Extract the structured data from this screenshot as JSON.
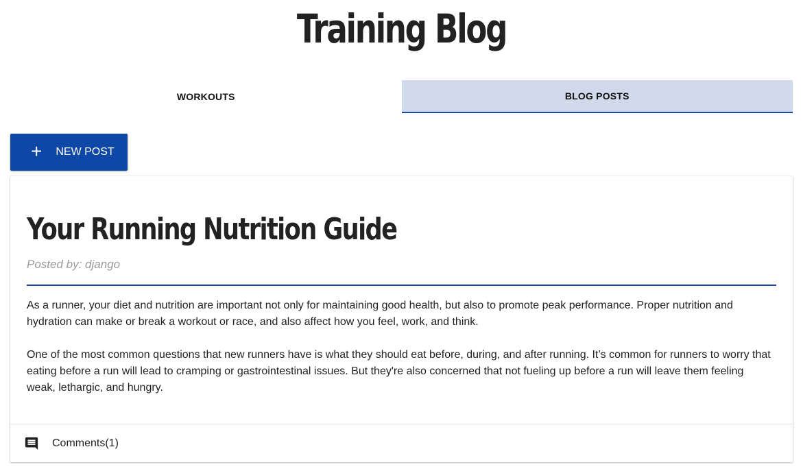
{
  "header": {
    "title": "Training Blog"
  },
  "tabs": [
    {
      "label": "WORKOUTS",
      "active": false
    },
    {
      "label": "BLOG POSTS",
      "active": true
    }
  ],
  "toolbar": {
    "new_post_label": "NEW POST",
    "new_post_icon": "plus-icon"
  },
  "post": {
    "title": "Your Running Nutrition Guide",
    "posted_by": "Posted by: django",
    "paragraphs": [
      "As a runner, your diet and nutrition are important not only for maintaining good health, but also to promote peak performance. Proper nutrition and hydration can make or break a workout or race, and also affect how you feel, work, and think.",
      "One of the most common questions that new runners have is what they should eat before, during, and after running. It’s common for runners to worry that eating before a run will lead to cramping or gastrointestinal issues. But they're also concerned that not fueling up before a run will leave them feeling weak, lethargic, and hungry."
    ],
    "comments_label": "Comments(1)",
    "comments_icon": "comment-icon"
  },
  "colors": {
    "accent": "#0f47a6",
    "active_tab_bg": "#d1daea",
    "divider": "#1a47a0"
  }
}
